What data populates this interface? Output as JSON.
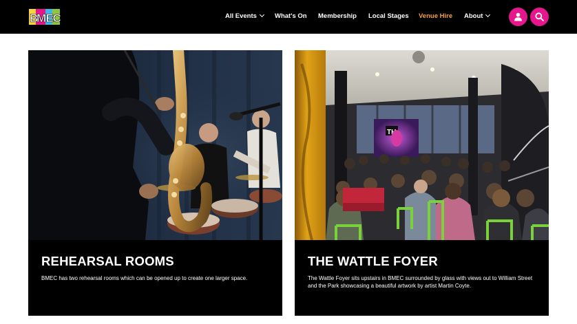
{
  "header": {
    "logo_text": "BMEC",
    "nav": [
      {
        "label": "All Events",
        "has_dropdown": true
      },
      {
        "label": "What's On",
        "has_dropdown": false
      },
      {
        "label": "Membership",
        "has_dropdown": false
      },
      {
        "label": "Local Stages",
        "has_dropdown": false
      },
      {
        "label": "Venue Hire",
        "has_dropdown": false,
        "active": true
      },
      {
        "label": "About",
        "has_dropdown": true
      }
    ],
    "account_icon": "user-icon",
    "search_icon": "search-icon"
  },
  "colors": {
    "header_bg": "#000000",
    "accent_pink": "#e6168d",
    "active_nav": "#f5a13a",
    "card_bg": "#000000"
  },
  "cards": [
    {
      "title": "REHEARSAL ROOMS",
      "description": "BMEC has two rehearsal rooms which can be opened up to create one larger space."
    },
    {
      "title": "THE WATTLE FOYER",
      "description": "The Wattle Foyer sits upstairs in BMEC surrounded by glass with views out to William Street and the Park showcasing a beautiful artwork by artist Martin Coyte."
    }
  ]
}
